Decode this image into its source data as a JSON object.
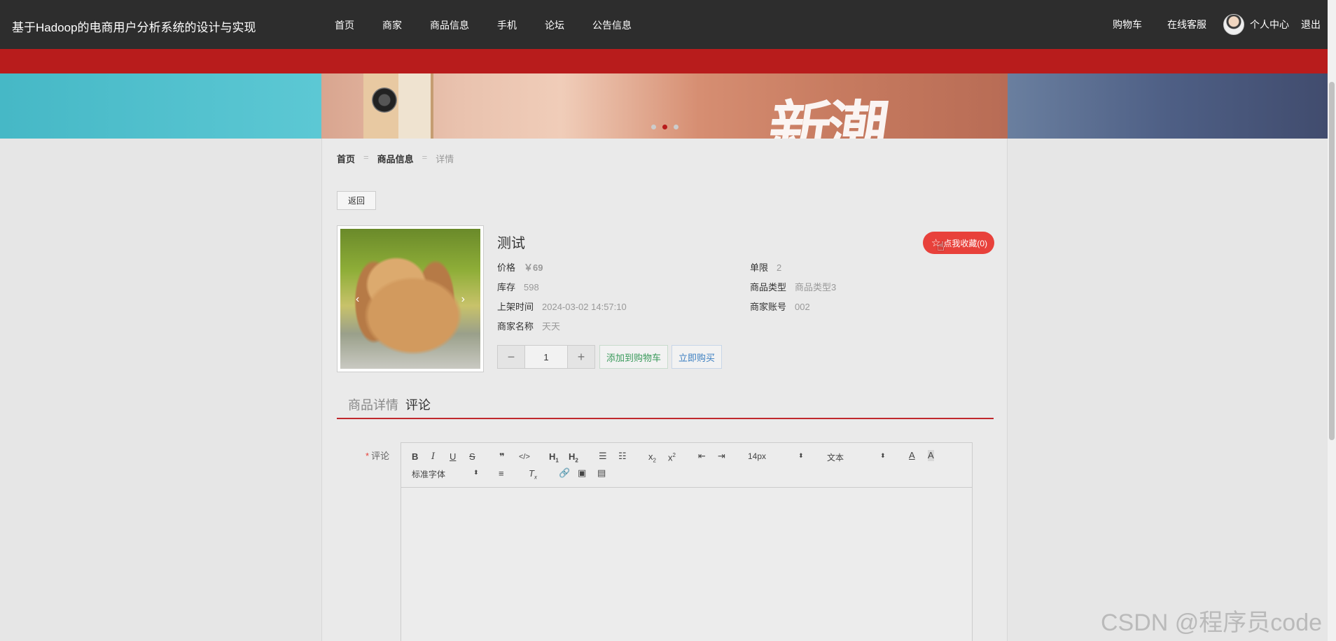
{
  "site_title": "基于Hadoop的电商用户分析系统的设计与实现",
  "nav": {
    "items": [
      "首页",
      "商家",
      "商品信息",
      "手机",
      "论坛",
      "公告信息"
    ],
    "cart": "购物车",
    "service": "在线客服",
    "profile": "个人中心",
    "logout": "退出"
  },
  "banner": {
    "headline": "新潮",
    "slides": 3,
    "active_slide": 2
  },
  "breadcrumb": {
    "home": "首页",
    "section": "商品信息",
    "current": "详情",
    "separator": "="
  },
  "back_label": "返回",
  "product": {
    "name": "测试",
    "favorite": "点我收藏(0)",
    "price_label": "价格",
    "price": "￥69",
    "limit_label": "单限",
    "limit": "2",
    "stock_label": "库存",
    "stock": "598",
    "type_label": "商品类型",
    "type": "商品类型3",
    "listed_label": "上架时间",
    "listed": "2024-03-02 14:57:10",
    "merchant_account_label": "商家账号",
    "merchant_account": "002",
    "merchant_name_label": "商家名称",
    "merchant_name": "天天",
    "quantity": "1",
    "add_cart": "添加到购物车",
    "buy_now": "立即购买",
    "image_desc": "rabbit-photo"
  },
  "tabs": [
    "商品详情",
    "评论"
  ],
  "comment": {
    "required_mark": "*",
    "label": "评论"
  },
  "editor": {
    "buttons_row1": [
      "B",
      "I",
      "U",
      "S",
      "❞",
      "</>",
      "H1",
      "H2",
      "ol",
      "ul",
      "x₂",
      "x²",
      "outdent",
      "indent"
    ],
    "font_size": "14px",
    "block_type": "文本",
    "font_family": "标准字体"
  },
  "watermark": "CSDN @程序员code",
  "colors": {
    "nav_bg": "#2d2d2d",
    "accent_red": "#b81c1c",
    "favorite_red": "#e8413b",
    "cart_green": "#3a9a5b",
    "buy_blue": "#3c7fc1"
  }
}
